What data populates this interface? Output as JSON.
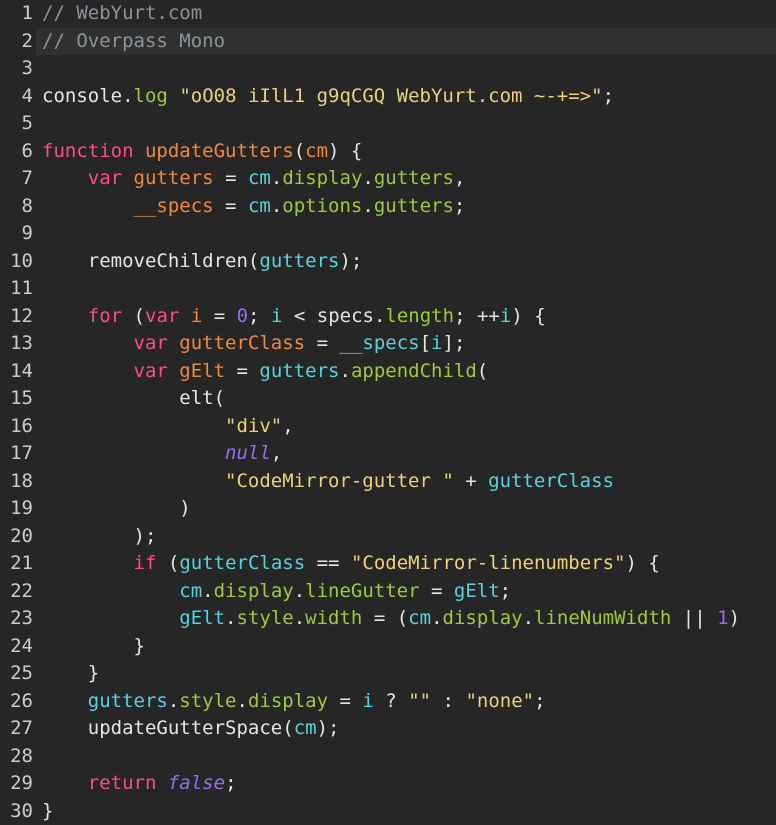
{
  "editor": {
    "name": "code-editor",
    "font_label": "Overpass Mono",
    "theme": {
      "background": "#262626",
      "active_line_background": "#30302f",
      "line_number": "#c9cdd1",
      "comment": "#8b949e",
      "keyword": "#ff4d84",
      "definition": "#f0883e",
      "variable": "#56d4dd",
      "property": "#9ccc3c",
      "string": "#ecd27a",
      "number": "#9a6cf0",
      "atom": "#9a6cf0",
      "plain": "#e6e6e3"
    },
    "total_lines": 30,
    "active_line": 2,
    "lines": [
      {
        "n": "1",
        "active": false,
        "tokens": [
          {
            "t": "// WebYurt.com",
            "c": "t-com"
          }
        ]
      },
      {
        "n": "2",
        "active": true,
        "tokens": [
          {
            "t": "// Overpass Mono",
            "c": "t-com"
          }
        ]
      },
      {
        "n": "3",
        "active": false,
        "tokens": []
      },
      {
        "n": "4",
        "active": false,
        "tokens": [
          {
            "t": "console",
            "c": "t-plain"
          },
          {
            "t": ".",
            "c": "t-punc"
          },
          {
            "t": "log",
            "c": "t-prop"
          },
          {
            "t": " ",
            "c": "t-plain"
          },
          {
            "t": "\"oO08 iIlL1 g9qCGQ WebYurt.com ~-+=>\"",
            "c": "t-str"
          },
          {
            "t": ";",
            "c": "t-punc"
          }
        ]
      },
      {
        "n": "5",
        "active": false,
        "tokens": []
      },
      {
        "n": "6",
        "active": false,
        "tokens": [
          {
            "t": "function",
            "c": "t-kw"
          },
          {
            "t": " ",
            "c": "t-plain"
          },
          {
            "t": "updateGutters",
            "c": "t-def"
          },
          {
            "t": "(",
            "c": "t-punc"
          },
          {
            "t": "cm",
            "c": "t-def"
          },
          {
            "t": ")",
            "c": "t-punc"
          },
          {
            "t": " {",
            "c": "t-punc"
          }
        ]
      },
      {
        "n": "7",
        "active": false,
        "tokens": [
          {
            "t": "    ",
            "c": "t-plain"
          },
          {
            "t": "var",
            "c": "t-kw"
          },
          {
            "t": " ",
            "c": "t-plain"
          },
          {
            "t": "gutters",
            "c": "t-def"
          },
          {
            "t": " ",
            "c": "t-plain"
          },
          {
            "t": "=",
            "c": "t-op"
          },
          {
            "t": " ",
            "c": "t-plain"
          },
          {
            "t": "cm",
            "c": "t-var"
          },
          {
            "t": ".",
            "c": "t-punc"
          },
          {
            "t": "display",
            "c": "t-prop"
          },
          {
            "t": ".",
            "c": "t-punc"
          },
          {
            "t": "gutters",
            "c": "t-prop"
          },
          {
            "t": ",",
            "c": "t-punc"
          }
        ]
      },
      {
        "n": "8",
        "active": false,
        "tokens": [
          {
            "t": "        ",
            "c": "t-plain"
          },
          {
            "t": "__specs",
            "c": "t-def"
          },
          {
            "t": " ",
            "c": "t-plain"
          },
          {
            "t": "=",
            "c": "t-op"
          },
          {
            "t": " ",
            "c": "t-plain"
          },
          {
            "t": "cm",
            "c": "t-var"
          },
          {
            "t": ".",
            "c": "t-punc"
          },
          {
            "t": "options",
            "c": "t-prop"
          },
          {
            "t": ".",
            "c": "t-punc"
          },
          {
            "t": "gutters",
            "c": "t-prop"
          },
          {
            "t": ";",
            "c": "t-punc"
          }
        ]
      },
      {
        "n": "9",
        "active": false,
        "tokens": []
      },
      {
        "n": "10",
        "active": false,
        "tokens": [
          {
            "t": "    ",
            "c": "t-plain"
          },
          {
            "t": "removeChildren",
            "c": "t-plain"
          },
          {
            "t": "(",
            "c": "t-punc"
          },
          {
            "t": "gutters",
            "c": "t-var"
          },
          {
            "t": ")",
            "c": "t-punc"
          },
          {
            "t": ";",
            "c": "t-punc"
          }
        ]
      },
      {
        "n": "11",
        "active": false,
        "tokens": []
      },
      {
        "n": "12",
        "active": false,
        "tokens": [
          {
            "t": "    ",
            "c": "t-plain"
          },
          {
            "t": "for",
            "c": "t-kw"
          },
          {
            "t": " ",
            "c": "t-plain"
          },
          {
            "t": "(",
            "c": "t-punc"
          },
          {
            "t": "var",
            "c": "t-kw"
          },
          {
            "t": " ",
            "c": "t-plain"
          },
          {
            "t": "i",
            "c": "t-def"
          },
          {
            "t": " ",
            "c": "t-plain"
          },
          {
            "t": "=",
            "c": "t-op"
          },
          {
            "t": " ",
            "c": "t-plain"
          },
          {
            "t": "0",
            "c": "t-num"
          },
          {
            "t": ";",
            "c": "t-punc"
          },
          {
            "t": " ",
            "c": "t-plain"
          },
          {
            "t": "i",
            "c": "t-var"
          },
          {
            "t": " ",
            "c": "t-plain"
          },
          {
            "t": "<",
            "c": "t-op"
          },
          {
            "t": " ",
            "c": "t-plain"
          },
          {
            "t": "specs",
            "c": "t-plain"
          },
          {
            "t": ".",
            "c": "t-punc"
          },
          {
            "t": "length",
            "c": "t-prop"
          },
          {
            "t": ";",
            "c": "t-punc"
          },
          {
            "t": " ",
            "c": "t-plain"
          },
          {
            "t": "++",
            "c": "t-op"
          },
          {
            "t": "i",
            "c": "t-var"
          },
          {
            "t": ")",
            "c": "t-punc"
          },
          {
            "t": " {",
            "c": "t-punc"
          }
        ]
      },
      {
        "n": "13",
        "active": false,
        "tokens": [
          {
            "t": "        ",
            "c": "t-plain"
          },
          {
            "t": "var",
            "c": "t-kw"
          },
          {
            "t": " ",
            "c": "t-plain"
          },
          {
            "t": "gutterClass",
            "c": "t-def"
          },
          {
            "t": " ",
            "c": "t-plain"
          },
          {
            "t": "=",
            "c": "t-op"
          },
          {
            "t": " ",
            "c": "t-plain"
          },
          {
            "t": "__specs",
            "c": "t-var"
          },
          {
            "t": "[",
            "c": "t-punc"
          },
          {
            "t": "i",
            "c": "t-var"
          },
          {
            "t": "]",
            "c": "t-punc"
          },
          {
            "t": ";",
            "c": "t-punc"
          }
        ]
      },
      {
        "n": "14",
        "active": false,
        "tokens": [
          {
            "t": "        ",
            "c": "t-plain"
          },
          {
            "t": "var",
            "c": "t-kw"
          },
          {
            "t": " ",
            "c": "t-plain"
          },
          {
            "t": "gElt",
            "c": "t-def"
          },
          {
            "t": " ",
            "c": "t-plain"
          },
          {
            "t": "=",
            "c": "t-op"
          },
          {
            "t": " ",
            "c": "t-plain"
          },
          {
            "t": "gutters",
            "c": "t-var"
          },
          {
            "t": ".",
            "c": "t-punc"
          },
          {
            "t": "appendChild",
            "c": "t-prop"
          },
          {
            "t": "(",
            "c": "t-punc"
          }
        ]
      },
      {
        "n": "15",
        "active": false,
        "tokens": [
          {
            "t": "            ",
            "c": "t-plain"
          },
          {
            "t": "elt",
            "c": "t-plain"
          },
          {
            "t": "(",
            "c": "t-punc"
          }
        ]
      },
      {
        "n": "16",
        "active": false,
        "tokens": [
          {
            "t": "                ",
            "c": "t-plain"
          },
          {
            "t": "\"div\"",
            "c": "t-str"
          },
          {
            "t": ",",
            "c": "t-punc"
          }
        ]
      },
      {
        "n": "17",
        "active": false,
        "tokens": [
          {
            "t": "                ",
            "c": "t-plain"
          },
          {
            "t": "null",
            "c": "t-atom"
          },
          {
            "t": ",",
            "c": "t-punc"
          }
        ]
      },
      {
        "n": "18",
        "active": false,
        "tokens": [
          {
            "t": "                ",
            "c": "t-plain"
          },
          {
            "t": "\"CodeMirror-gutter \"",
            "c": "t-str"
          },
          {
            "t": " ",
            "c": "t-plain"
          },
          {
            "t": "+",
            "c": "t-op"
          },
          {
            "t": " ",
            "c": "t-plain"
          },
          {
            "t": "gutterClass",
            "c": "t-var"
          }
        ]
      },
      {
        "n": "19",
        "active": false,
        "tokens": [
          {
            "t": "            ",
            "c": "t-plain"
          },
          {
            "t": ")",
            "c": "t-punc"
          }
        ]
      },
      {
        "n": "20",
        "active": false,
        "tokens": [
          {
            "t": "        ",
            "c": "t-plain"
          },
          {
            "t": ")",
            "c": "t-punc"
          },
          {
            "t": ";",
            "c": "t-punc"
          }
        ]
      },
      {
        "n": "21",
        "active": false,
        "tokens": [
          {
            "t": "        ",
            "c": "t-plain"
          },
          {
            "t": "if",
            "c": "t-kw"
          },
          {
            "t": " ",
            "c": "t-plain"
          },
          {
            "t": "(",
            "c": "t-punc"
          },
          {
            "t": "gutterClass",
            "c": "t-var"
          },
          {
            "t": " ",
            "c": "t-plain"
          },
          {
            "t": "==",
            "c": "t-op"
          },
          {
            "t": " ",
            "c": "t-plain"
          },
          {
            "t": "\"CodeMirror-linenumbers\"",
            "c": "t-str"
          },
          {
            "t": ")",
            "c": "t-punc"
          },
          {
            "t": " {",
            "c": "t-punc"
          }
        ]
      },
      {
        "n": "22",
        "active": false,
        "tokens": [
          {
            "t": "            ",
            "c": "t-plain"
          },
          {
            "t": "cm",
            "c": "t-var"
          },
          {
            "t": ".",
            "c": "t-punc"
          },
          {
            "t": "display",
            "c": "t-prop"
          },
          {
            "t": ".",
            "c": "t-punc"
          },
          {
            "t": "lineGutter",
            "c": "t-prop"
          },
          {
            "t": " ",
            "c": "t-plain"
          },
          {
            "t": "=",
            "c": "t-op"
          },
          {
            "t": " ",
            "c": "t-plain"
          },
          {
            "t": "gElt",
            "c": "t-var"
          },
          {
            "t": ";",
            "c": "t-punc"
          }
        ]
      },
      {
        "n": "23",
        "active": false,
        "tokens": [
          {
            "t": "            ",
            "c": "t-plain"
          },
          {
            "t": "gElt",
            "c": "t-var"
          },
          {
            "t": ".",
            "c": "t-punc"
          },
          {
            "t": "style",
            "c": "t-prop"
          },
          {
            "t": ".",
            "c": "t-punc"
          },
          {
            "t": "width",
            "c": "t-prop"
          },
          {
            "t": " ",
            "c": "t-plain"
          },
          {
            "t": "=",
            "c": "t-op"
          },
          {
            "t": " ",
            "c": "t-plain"
          },
          {
            "t": "(",
            "c": "t-punc"
          },
          {
            "t": "cm",
            "c": "t-var"
          },
          {
            "t": ".",
            "c": "t-punc"
          },
          {
            "t": "display",
            "c": "t-prop"
          },
          {
            "t": ".",
            "c": "t-punc"
          },
          {
            "t": "lineNumWidth",
            "c": "t-prop"
          },
          {
            "t": " ",
            "c": "t-plain"
          },
          {
            "t": "||",
            "c": "t-op"
          },
          {
            "t": " ",
            "c": "t-plain"
          },
          {
            "t": "1",
            "c": "t-num"
          },
          {
            "t": ")",
            "c": "t-punc"
          }
        ]
      },
      {
        "n": "24",
        "active": false,
        "tokens": [
          {
            "t": "        ",
            "c": "t-plain"
          },
          {
            "t": "}",
            "c": "t-punc"
          }
        ]
      },
      {
        "n": "25",
        "active": false,
        "tokens": [
          {
            "t": "    ",
            "c": "t-plain"
          },
          {
            "t": "}",
            "c": "t-punc"
          }
        ]
      },
      {
        "n": "26",
        "active": false,
        "tokens": [
          {
            "t": "    ",
            "c": "t-plain"
          },
          {
            "t": "gutters",
            "c": "t-var"
          },
          {
            "t": ".",
            "c": "t-punc"
          },
          {
            "t": "style",
            "c": "t-prop"
          },
          {
            "t": ".",
            "c": "t-punc"
          },
          {
            "t": "display",
            "c": "t-prop"
          },
          {
            "t": " ",
            "c": "t-plain"
          },
          {
            "t": "=",
            "c": "t-op"
          },
          {
            "t": " ",
            "c": "t-plain"
          },
          {
            "t": "i",
            "c": "t-var"
          },
          {
            "t": " ",
            "c": "t-plain"
          },
          {
            "t": "?",
            "c": "t-op"
          },
          {
            "t": " ",
            "c": "t-plain"
          },
          {
            "t": "\"\"",
            "c": "t-str"
          },
          {
            "t": " ",
            "c": "t-plain"
          },
          {
            "t": ":",
            "c": "t-op"
          },
          {
            "t": " ",
            "c": "t-plain"
          },
          {
            "t": "\"none\"",
            "c": "t-str"
          },
          {
            "t": ";",
            "c": "t-punc"
          }
        ]
      },
      {
        "n": "27",
        "active": false,
        "tokens": [
          {
            "t": "    ",
            "c": "t-plain"
          },
          {
            "t": "updateGutterSpace",
            "c": "t-plain"
          },
          {
            "t": "(",
            "c": "t-punc"
          },
          {
            "t": "cm",
            "c": "t-var"
          },
          {
            "t": ")",
            "c": "t-punc"
          },
          {
            "t": ";",
            "c": "t-punc"
          }
        ]
      },
      {
        "n": "28",
        "active": false,
        "tokens": []
      },
      {
        "n": "29",
        "active": false,
        "tokens": [
          {
            "t": "    ",
            "c": "t-plain"
          },
          {
            "t": "return",
            "c": "t-kw"
          },
          {
            "t": " ",
            "c": "t-plain"
          },
          {
            "t": "false",
            "c": "t-atom"
          },
          {
            "t": ";",
            "c": "t-punc"
          }
        ]
      },
      {
        "n": "30",
        "active": false,
        "tokens": [
          {
            "t": "}",
            "c": "t-punc"
          }
        ]
      }
    ]
  }
}
